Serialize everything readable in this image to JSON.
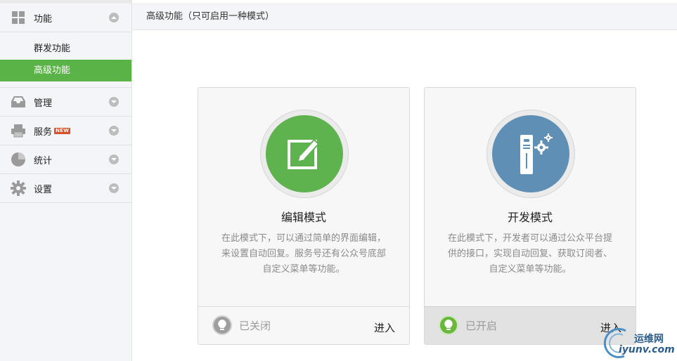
{
  "sidebar": {
    "groups": [
      {
        "label": "功能",
        "icon": "grid-icon",
        "expanded": true,
        "items": [
          {
            "label": "群发功能",
            "active": false
          },
          {
            "label": "高级功能",
            "active": true
          }
        ]
      },
      {
        "label": "管理",
        "icon": "inbox-icon"
      },
      {
        "label": "服务",
        "icon": "printer-icon",
        "badge": "NEW"
      },
      {
        "label": "统计",
        "icon": "pie-chart-icon"
      },
      {
        "label": "设置",
        "icon": "gear-icon"
      }
    ]
  },
  "header": {
    "title": "高级功能（只可启用一种模式）"
  },
  "cards": [
    {
      "title": "编辑模式",
      "icon": "edit-icon",
      "desc_lines": [
        "在此模式下，可以通过简单的界面编辑，",
        "来设置自动回复。服务号还有公众号底部",
        "自定义菜单等功能。"
      ],
      "status": "已关闭",
      "enabled": false,
      "enter_label": "进入"
    },
    {
      "title": "开发模式",
      "icon": "server-gear-icon",
      "desc_lines": [
        "在此模式下，开发者可以通过公众平台提",
        "供的接口，实现自动回复、获取订阅者、",
        "自定义菜单等功能。"
      ],
      "status": "已开启",
      "enabled": true,
      "enter_label": "进入"
    }
  ],
  "watermark": {
    "line1": "运维网",
    "line2": "iyunv.com"
  },
  "colors": {
    "accent": "#5ab346",
    "edit_circle": "#5eb34e",
    "dev_circle": "#5f8fb4"
  }
}
